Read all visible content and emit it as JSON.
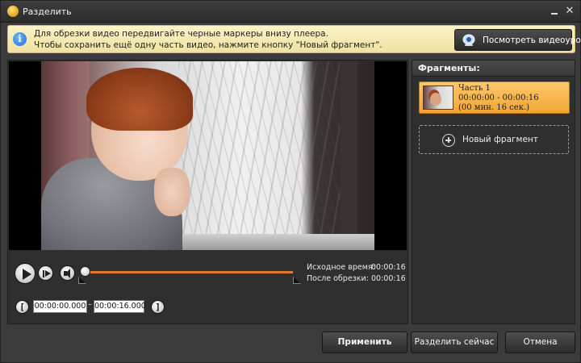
{
  "window": {
    "title": "Разделить"
  },
  "hint": {
    "line1": "Для обрезки видео передвигайте черные маркеры внизу плеера.",
    "line2": "Чтобы сохранить ещё одну часть видео, нажмите кнопку \"Новый фрагмент\".",
    "tutorial_label": "Посмотреть видеоурок"
  },
  "player": {
    "progress_fraction": 0.0,
    "source_time_label": "Исходное время:",
    "source_time_value": "00:00:16",
    "after_trim_label": "После обрезки:",
    "after_trim_value": "00:00:16",
    "start_field": "00:00:00.000",
    "end_field": "00:00:16.000",
    "range_separator": "–",
    "bracket_left": "[",
    "bracket_right": "]"
  },
  "fragments": {
    "title": "Фрагменты:",
    "items": [
      {
        "name": "Часть 1",
        "range": "00:00:00 - 00:00:16",
        "duration": "(00 мин. 16 сек.)"
      }
    ],
    "new_label": "Новый фрагмент"
  },
  "actions": {
    "apply": "Применить",
    "split_now": "Разделить сейчас",
    "cancel": "Отмена"
  },
  "colors": {
    "accent_orange": "#e0763a",
    "fragment_selected": "#f0a533",
    "hint_bg": "#f5e9b3"
  }
}
